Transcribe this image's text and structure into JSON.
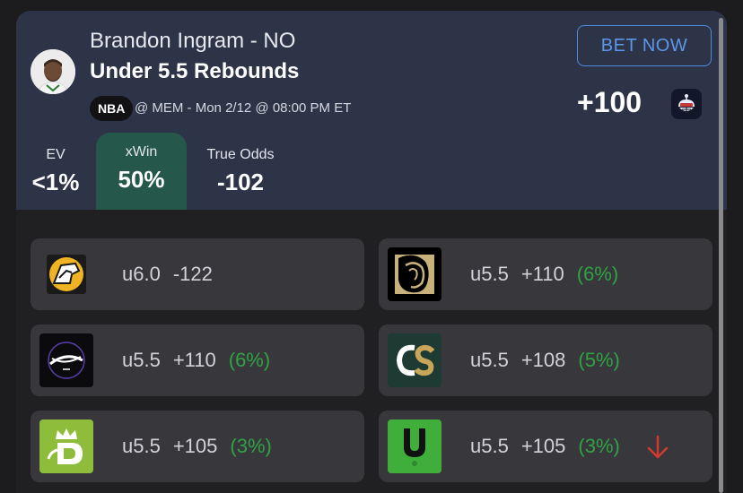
{
  "prop": {
    "player": "Brandon Ingram - NO",
    "market": "Under 5.5 Rebounds",
    "league": "NBA",
    "game": "@ MEM - Mon 2/12 @ 08:00 PM ET",
    "bet_label": "BET NOW",
    "best_odds": "+100"
  },
  "stats": [
    {
      "label": "EV",
      "value": "<1%"
    },
    {
      "label": "xWin",
      "value": "50%"
    },
    {
      "label": "True Odds",
      "value": "-102"
    }
  ],
  "books": [
    {
      "logo": "fanatics-logo",
      "line": "u6.0",
      "odds": "-122",
      "edge": ""
    },
    {
      "logo": "betmgm-logo",
      "line": "u5.5",
      "odds": "+110",
      "edge": "(6%)"
    },
    {
      "logo": "hardrock-logo",
      "line": "u5.5",
      "odds": "+110",
      "edge": "(6%)"
    },
    {
      "logo": "caesars-logo",
      "line": "u5.5",
      "odds": "+108",
      "edge": "(5%)"
    },
    {
      "logo": "draftkings-logo",
      "line": "u5.5",
      "odds": "+105",
      "edge": "(3%)"
    },
    {
      "logo": "underdog-logo",
      "line": "u5.5",
      "odds": "+105",
      "edge": "(3%)",
      "trend": "down-arrow-icon"
    }
  ],
  "colors": {
    "card": "#2e3448",
    "xwin_highlight": "#25584a",
    "edge_positive": "#2fa344",
    "trend_down": "#d03a31",
    "bet_button": "#4f8bdb"
  }
}
